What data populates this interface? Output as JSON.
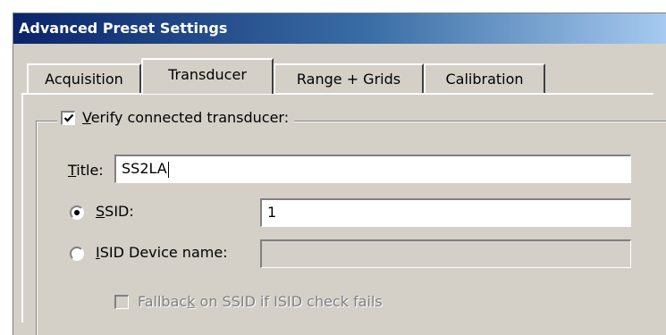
{
  "window": {
    "title": "Advanced Preset Settings"
  },
  "tabs": [
    {
      "label": "Acquisition"
    },
    {
      "label": "Transducer"
    },
    {
      "label": "Range + Grids"
    },
    {
      "label": "Calibration"
    }
  ],
  "active_tab": "Transducer",
  "verify_group": {
    "checked": true,
    "label_pre": "",
    "label_mnemonic": "V",
    "label_post": "erify connected transducer:"
  },
  "title_field": {
    "label_mnemonic": "T",
    "label_post": "itle:",
    "value": "SS2LA"
  },
  "ssid": {
    "selected": true,
    "label_mnemonic": "S",
    "label_post": "SID:",
    "value": "1"
  },
  "isid": {
    "selected": false,
    "label_mnemonic": "I",
    "label_post": "SID Device name:",
    "value": ""
  },
  "fallback": {
    "checked": false,
    "label_pre": "Fallbac",
    "label_mnemonic": "k",
    "label_post": " on SSID if ISID check fails"
  }
}
